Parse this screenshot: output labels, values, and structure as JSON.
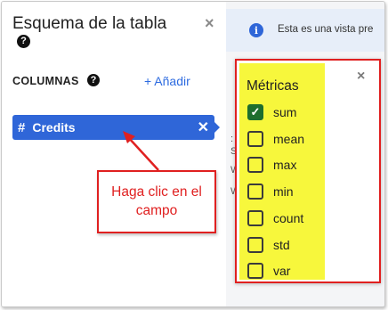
{
  "panel": {
    "title": "Esquema de la tabla",
    "title_help_icon": "question-circle-icon",
    "close_icon": "close-icon",
    "close_glyph": "×"
  },
  "columns": {
    "label": "COLUMNAS",
    "help_icon": "question-circle-icon",
    "help_glyph": "?",
    "add_label": "+ Añadir"
  },
  "field": {
    "type_glyph": "#",
    "name": "Credits",
    "remove_glyph": "✕"
  },
  "preview": {
    "info_icon": "info-icon",
    "info_glyph": "i",
    "info_text": "Esta es una vista pre",
    "peek_lines": [
      ":",
      "S",
      "W",
      "W"
    ]
  },
  "metrics": {
    "title": "Métricas",
    "close_glyph": "×",
    "options": [
      {
        "label": "sum",
        "checked": true
      },
      {
        "label": "mean",
        "checked": false
      },
      {
        "label": "max",
        "checked": false
      },
      {
        "label": "min",
        "checked": false
      },
      {
        "label": "count",
        "checked": false
      },
      {
        "label": "std",
        "checked": false
      },
      {
        "label": "var",
        "checked": false
      }
    ]
  },
  "annotation": {
    "text": "Haga clic en el campo",
    "color": "#e02020"
  },
  "colors": {
    "accent": "#2f66d8",
    "highlight": "#f7f73c",
    "checked": "#1e6e2e"
  }
}
